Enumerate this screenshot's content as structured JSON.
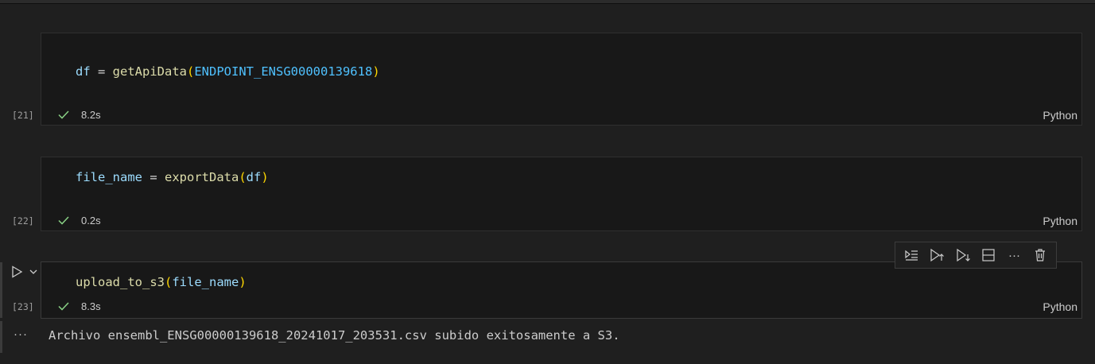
{
  "cells": [
    {
      "exec_count": "[21]",
      "code": {
        "var": "df",
        "op": " = ",
        "fn": "getApiData",
        "open": "(",
        "arg": "ENDPOINT_ENSG00000139618",
        "close": ")"
      },
      "duration": "8.2s",
      "language": "Python"
    },
    {
      "exec_count": "[22]",
      "code": {
        "var": "file_name",
        "op": " = ",
        "fn": "exportData",
        "open": "(",
        "arg": "df",
        "close": ")"
      },
      "duration": "0.2s",
      "language": "Python"
    },
    {
      "exec_count": "[23]",
      "code": {
        "fn": "upload_to_s3",
        "open": "(",
        "arg": "file_name",
        "close": ")"
      },
      "duration": "8.3s",
      "language": "Python"
    }
  ],
  "output": {
    "more": "···",
    "text": "Archivo ensembl_ENSG00000139618_20241017_203531.csv subido exitosamente a S3."
  },
  "toolbar_more": "···",
  "icons": {
    "check_color": "#89d185",
    "accent": "#4fc1ff"
  }
}
